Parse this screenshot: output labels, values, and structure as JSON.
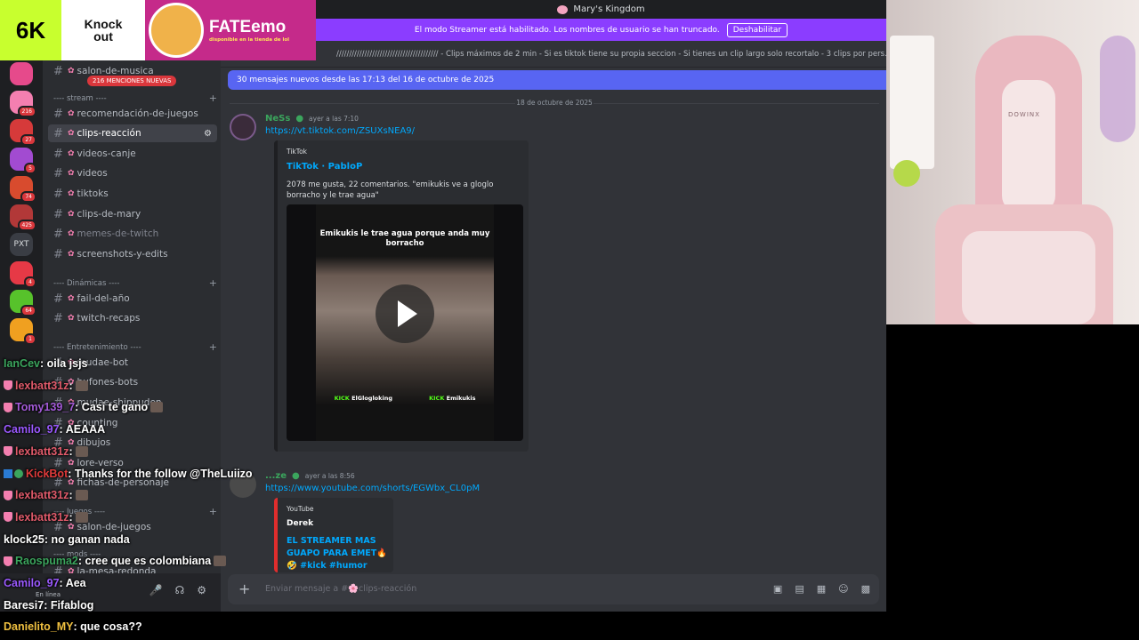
{
  "titlebar": {
    "title": "Mary's Kingdom"
  },
  "streamer_bar": {
    "text": "El modo Streamer está habilitado. Los nombres de usuario se han truncado.",
    "button": "Deshabilitar"
  },
  "logos": {
    "sixk": "6K",
    "knockout_1": "Knock",
    "knockout_2": "out",
    "fate_big": "FATEemo",
    "fate_small": "disponible en la tienda de lol"
  },
  "rail": {
    "servers": [
      {
        "badge": ""
      },
      {
        "badge": "216"
      },
      {
        "badge": "27"
      },
      {
        "badge": "5"
      },
      {
        "badge": "74"
      },
      {
        "badge": "425"
      },
      {
        "badge": "PXT"
      },
      {
        "badge": "4"
      },
      {
        "badge": "64"
      },
      {
        "badge": "1"
      }
    ],
    "colors": [
      "#e64a8b",
      "#f47fb0",
      "#d63a3a",
      "#a24bd1",
      "#d84b2e",
      "#b23838",
      "#3a3d44",
      "#e63946",
      "#57c22b",
      "#f0a020"
    ]
  },
  "sidebar": {
    "mention_pill": "216 MENCIONES NUEVAS",
    "top_channel": "salon-de-musica",
    "categories": {
      "stream": "---- stream ----",
      "dinamicas": "---- Dinámicas ----",
      "entretenimiento": "---- Entretenimiento ----",
      "juegos": "---- Juegos ----",
      "mods": "---- mods ----"
    },
    "channels": {
      "c1": "recomendación-de-juegos",
      "c2": "clips-reacción",
      "c3": "videos-canje",
      "c4": "videos",
      "c5": "tiktoks",
      "c6": "clips-de-mary",
      "c7": "memes-de-twitch",
      "c8": "screenshots-y-edits",
      "c9": "fail-del-año",
      "c10": "twitch-recaps",
      "c11": "mudae-bot",
      "c12": "bufones-bots",
      "c13": "mudae-shippuden",
      "c14": "counting",
      "c15": "dibujos",
      "c16": "lore-verso",
      "c17": "fichas-de-personaje",
      "c18": "salon-de-juegos",
      "c19": "la-mesa-redonda"
    }
  },
  "user_panel": {
    "status": "En línea"
  },
  "main": {
    "topic": "//////////////////////////////////////// - Clips máximos de 2 min - Si es tiktok tiene su propia seccion - Si tienes un clip largo solo recortalo - 3 clips por pers...",
    "new_messages": "30 mensajes nuevos desde las 17:13 del 16 de octubre de 2025",
    "date_separator": "18 de octubre de 2025",
    "msg1": {
      "author": "NeSs",
      "time": "ayer a las 7:10",
      "link": "https://vt.tiktok.com/ZSUXsNEA9/",
      "embed_provider": "TikTok",
      "embed_title": "TikTok · PabloP",
      "embed_desc": "2078 me gusta, 22 comentarios. \"emikukis ve a gloglo borracho y le trae agua\"",
      "video_caption": "Emikukis le trae agua porque anda muy borracho",
      "kick1": "KICK",
      "kick1_name": "ElGlogloking",
      "kick2": "KICK",
      "kick2_name": "Emikukis"
    },
    "msg2": {
      "author": "...ze",
      "time": "ayer a las 8:56",
      "link": "https://www.youtube.com/shorts/EGWbx_CL0pM",
      "embed_provider": "YouTube",
      "embed_author": "Derek",
      "embed_title": "EL STREAMER MAS GUAPO PARA EMET🔥",
      "embed_tags": "🤣 #kick #humor"
    },
    "composer_placeholder": "Enviar mensaje a #🌸clips-reacción"
  },
  "webcam": {
    "brand": "DOWINX"
  },
  "chat_overlay": [
    {
      "user": "IanCev",
      "color": "#3ba55d",
      "msg": ": oila jsjs",
      "badge": "none"
    },
    {
      "user": "lexbatt31z",
      "color": "#e05a6a",
      "msg": " :",
      "badge": "mod"
    },
    {
      "user": "Tomy139_7",
      "color": "#a35ad8",
      "msg": " : Casi te gano",
      "badge": "mod"
    },
    {
      "user": "Camilo_97",
      "color": "#9b59ff",
      "msg": " : AEAAA",
      "badge": "none"
    },
    {
      "user": "lexbatt31z",
      "color": "#e05a6a",
      "msg": " :",
      "badge": "mod"
    },
    {
      "user": "KickBot",
      "color": "#e03a3a",
      "msg": " : Thanks for the follow @TheLuiizo",
      "badge": "bot"
    },
    {
      "user": "lexbatt31z",
      "color": "#e05a6a",
      "msg": " :",
      "badge": "mod"
    },
    {
      "user": "lexbatt31z",
      "color": "#e05a6a",
      "msg": " :",
      "badge": "mod"
    },
    {
      "user": "klock25",
      "color": "#ffffff",
      "msg": " : no ganan nada",
      "badge": "none"
    },
    {
      "user": "Raospuma2",
      "color": "#3ba55d",
      "msg": " : cree que es colombiana",
      "badge": "mod"
    },
    {
      "user": "Camilo_97",
      "color": "#9b59ff",
      "msg": " : Aea",
      "badge": "none"
    },
    {
      "user": "Baresi7",
      "color": "#ffffff",
      "msg": " : Fifablog",
      "badge": "none"
    },
    {
      "user": "Danielito_MY",
      "color": "#f0c040",
      "msg": " : que cosa??",
      "badge": "none"
    }
  ]
}
